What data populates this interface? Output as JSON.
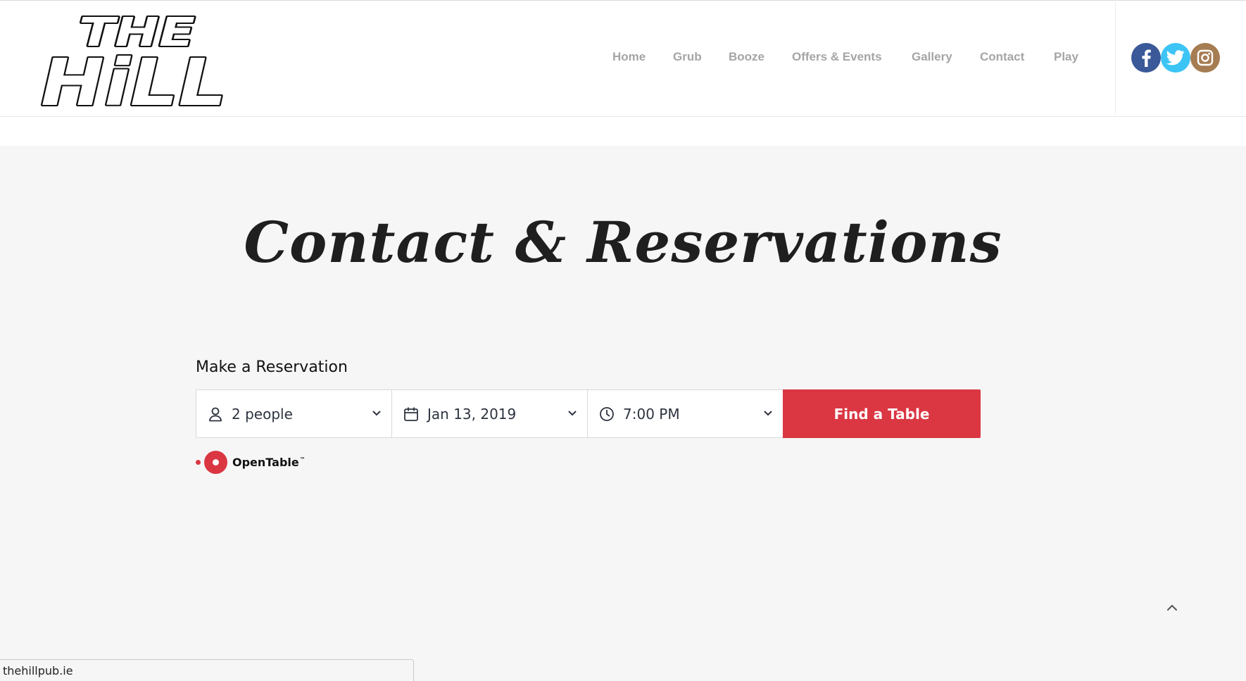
{
  "brand": {
    "logo_line1": "THE",
    "logo_line2": "HiLL"
  },
  "nav": {
    "items": [
      {
        "label": "Home"
      },
      {
        "label": "Grub"
      },
      {
        "label": "Booze"
      },
      {
        "label": "Offers & Events"
      },
      {
        "label": "Gallery"
      },
      {
        "label": "Contact"
      },
      {
        "label": "Play"
      }
    ]
  },
  "social": [
    {
      "icon": "facebook-icon",
      "color": "#3b5998"
    },
    {
      "icon": "twitter-icon",
      "color": "#3cc4f5"
    },
    {
      "icon": "instagram-icon",
      "color": "#a67c52"
    }
  ],
  "page": {
    "title": "Contact & Reservations"
  },
  "reservation": {
    "heading": "Make a Reservation",
    "party_size": "2 people",
    "date": "Jan 13, 2019",
    "time": "7:00 PM",
    "button_label": "Find a Table",
    "provider": "OpenTable",
    "provider_tm": "™",
    "accent_color": "#da3743"
  },
  "status_bar": {
    "url": "thehillpub.ie"
  }
}
